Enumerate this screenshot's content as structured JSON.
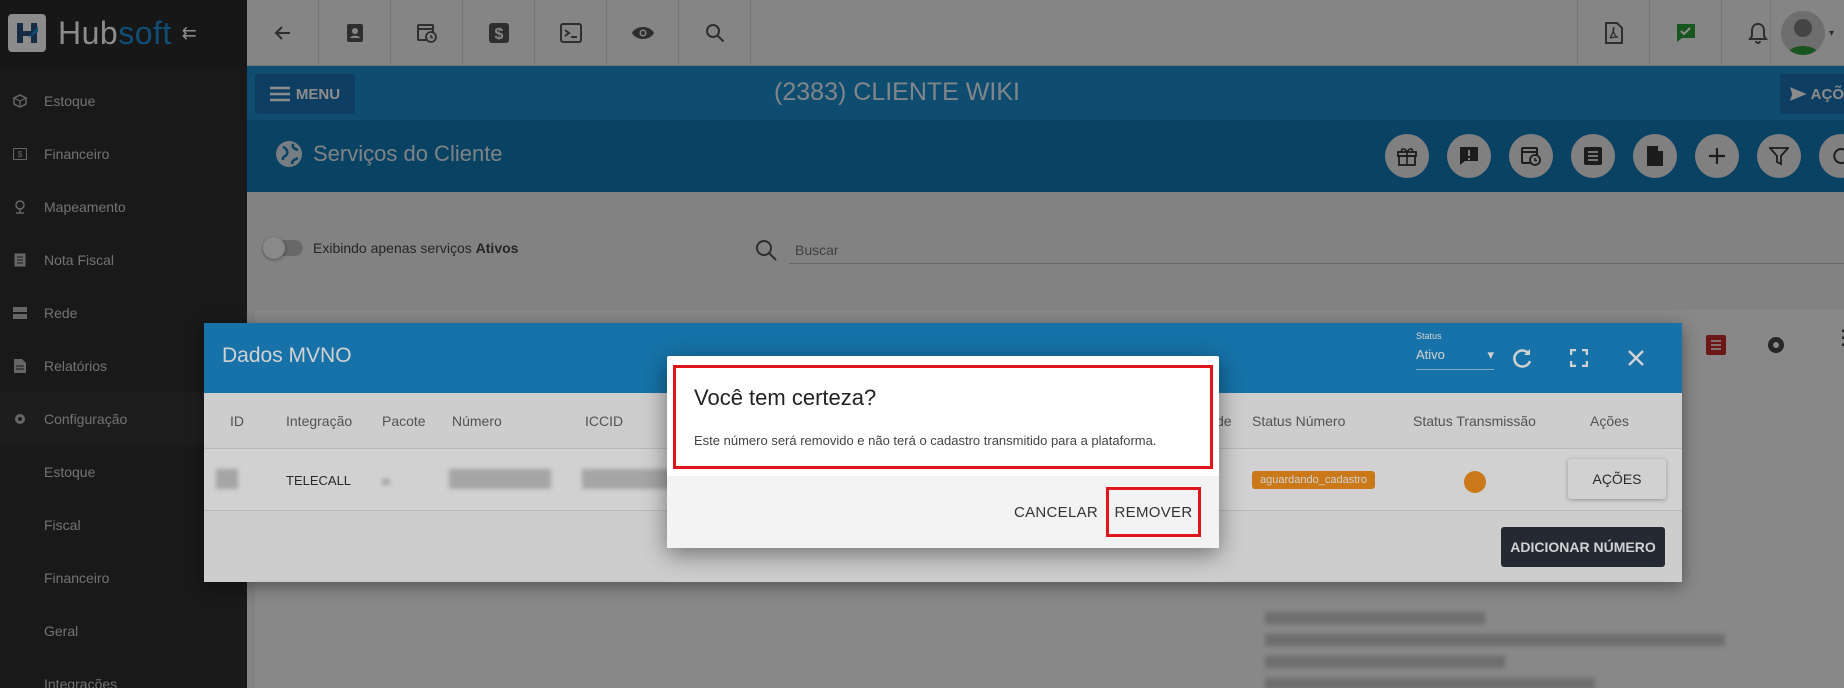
{
  "app": {
    "logo_hub": "Hub",
    "logo_soft": "soft"
  },
  "sidebar": {
    "items": [
      {
        "label": "Estoque",
        "icon": "box-icon"
      },
      {
        "label": "Financeiro",
        "icon": "money-icon"
      },
      {
        "label": "Mapeamento",
        "icon": "map-pin-icon"
      },
      {
        "label": "Nota Fiscal",
        "icon": "document-icon"
      },
      {
        "label": "Rede",
        "icon": "server-icon"
      },
      {
        "label": "Relatórios",
        "icon": "report-icon"
      },
      {
        "label": "Configuração",
        "icon": "gear-icon"
      }
    ],
    "subitems": [
      "Estoque",
      "Fiscal",
      "Financeiro",
      "Geral",
      "Integrações"
    ]
  },
  "header": {
    "menu_label": "MENU",
    "client_title": "(2383) CLIENTE WIKI",
    "acoes_label": "AÇÕ"
  },
  "services": {
    "title": "Serviços do Cliente"
  },
  "filters": {
    "toggle_text": "Exibindo apenas serviços",
    "toggle_bold": "Ativos",
    "search_placeholder": "Buscar"
  },
  "mvno_modal": {
    "title": "Dados MVNO",
    "status_label": "Status",
    "status_value": "Ativo",
    "columns": {
      "id": "ID",
      "integracao": "Integração",
      "pacote": "Pacote",
      "numero": "Número",
      "iccid": "ICCID",
      "partial": "de",
      "status_numero": "Status Número",
      "status_transmissao": "Status Transmissão",
      "acoes": "Ações"
    },
    "row": {
      "integracao": "TELECALL",
      "status_badge": "aguardando_cadastro",
      "acoes_button": "AÇÕES"
    },
    "add_button": "ADICIONAR NÚMERO"
  },
  "confirm_dialog": {
    "title": "Você tem certeza?",
    "message": "Este número será removido e não terá o cadastro transmitido para a plataforma.",
    "cancel_label": "CANCELAR",
    "remove_label": "REMOVER"
  },
  "colors": {
    "primary_blue": "#1b8ccd",
    "dark_blue": "#1378b6",
    "sidebar": "#2f2f2f",
    "badge_orange": "#f7931e",
    "highlight_red": "#e0141b"
  }
}
